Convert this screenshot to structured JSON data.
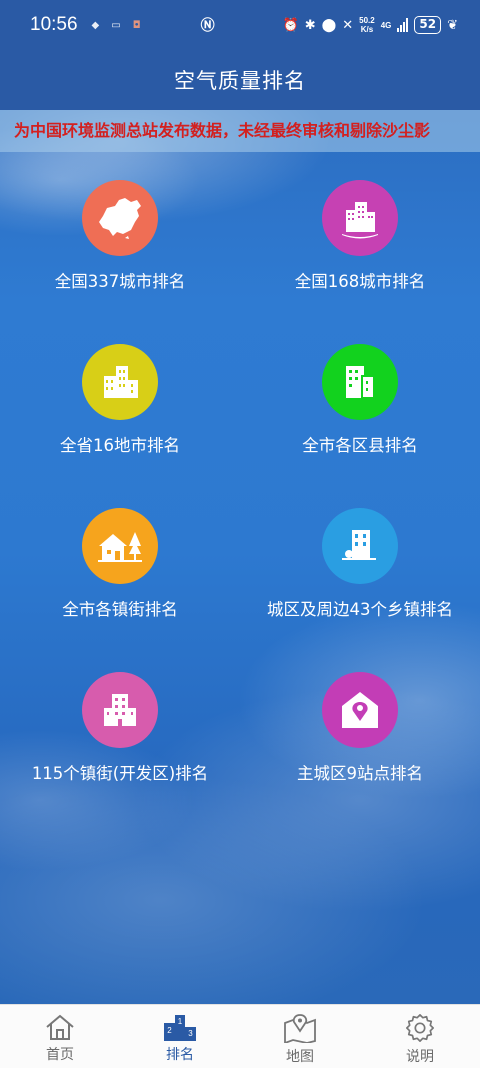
{
  "status_bar": {
    "time": "10:56",
    "net_speed_value": "50.2",
    "net_speed_unit": "K/s",
    "network": "4G",
    "battery": "52"
  },
  "header": {
    "title": "空气质量排名"
  },
  "notice": {
    "text": "为中国环境监测总站发布数据，未经最终审核和剔除沙尘影",
    "color": "#d3201f"
  },
  "tiles": [
    {
      "label": "全国337城市排名",
      "color": "#ef6e55",
      "icon": "china-map-icon"
    },
    {
      "label": "全国168城市排名",
      "color": "#c641b3",
      "icon": "city-skyline-icon"
    },
    {
      "label": "全省16地市排名",
      "color": "#d8cf17",
      "icon": "buildings-icon"
    },
    {
      "label": "全市各区县排名",
      "color": "#12d21e",
      "icon": "district-building-icon"
    },
    {
      "label": "全市各镇街排名",
      "color": "#f6a41d",
      "icon": "house-tree-icon"
    },
    {
      "label": "城区及周边43个乡镇排名",
      "color": "#2a9ee2",
      "icon": "town-building-icon"
    },
    {
      "label": "115个镇街(开发区)排名",
      "color": "#d75cad",
      "icon": "office-block-icon"
    },
    {
      "label": "主城区9站点排名",
      "color": "#c33db6",
      "icon": "home-pin-icon"
    }
  ],
  "bottom_nav": [
    {
      "label": "首页",
      "icon": "home-icon",
      "active": false
    },
    {
      "label": "排名",
      "icon": "ranking-podium-icon",
      "active": true
    },
    {
      "label": "地图",
      "icon": "map-pin-icon",
      "active": false
    },
    {
      "label": "说明",
      "icon": "gear-icon",
      "active": false
    }
  ],
  "colors": {
    "header_bg": "#2a5aa5",
    "active_nav": "#2a5aa5",
    "inactive_nav": "#6a6a6a"
  }
}
